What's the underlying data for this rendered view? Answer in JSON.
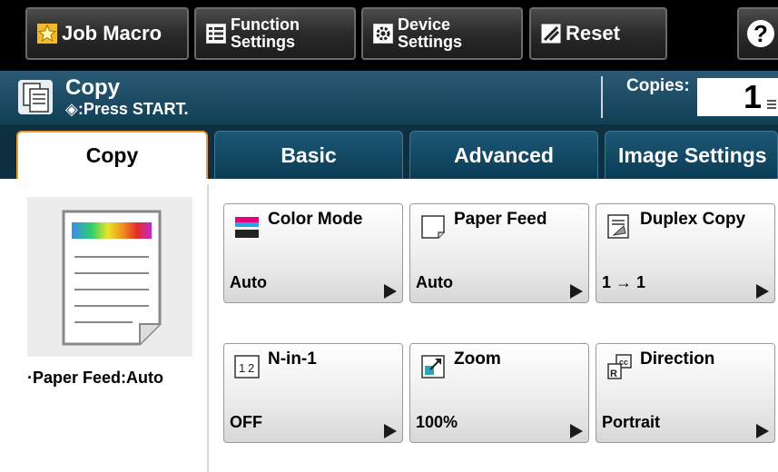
{
  "toolbar": {
    "job_macro": "Job Macro",
    "function_settings": [
      "Function",
      "Settings"
    ],
    "device_settings": [
      "Device",
      "Settings"
    ],
    "reset": "Reset",
    "help": "?"
  },
  "status": {
    "title": "Copy",
    "subtitle": "◈:Press START.",
    "copies_label": "Copies:",
    "copies_value": "1"
  },
  "tabs": [
    {
      "label": "Copy",
      "active": true
    },
    {
      "label": "Basic",
      "active": false
    },
    {
      "label": "Advanced",
      "active": false
    },
    {
      "label": "Image Settings",
      "active": false
    }
  ],
  "preview": {
    "paper_feed": "·Paper Feed:Auto"
  },
  "functions": [
    {
      "name": "Color Mode",
      "value": "Auto",
      "icon": "color-mode-icon"
    },
    {
      "name": "Paper Feed",
      "value": "Auto",
      "icon": "paper-feed-icon"
    },
    {
      "name": "Duplex Copy",
      "value": "1 → 1",
      "icon": "duplex-copy-icon"
    },
    {
      "name": "N-in-1",
      "value": "OFF",
      "icon": "n-in-1-icon"
    },
    {
      "name": "Zoom",
      "value": "100%",
      "icon": "zoom-icon"
    },
    {
      "name": "Direction",
      "value": "Portrait",
      "icon": "direction-icon"
    }
  ],
  "colors": {
    "status_bar": "#1d4f69",
    "tab_bar": "#0d2f40",
    "tab_active_border": "#f29b28",
    "toolbar": "#000000"
  }
}
